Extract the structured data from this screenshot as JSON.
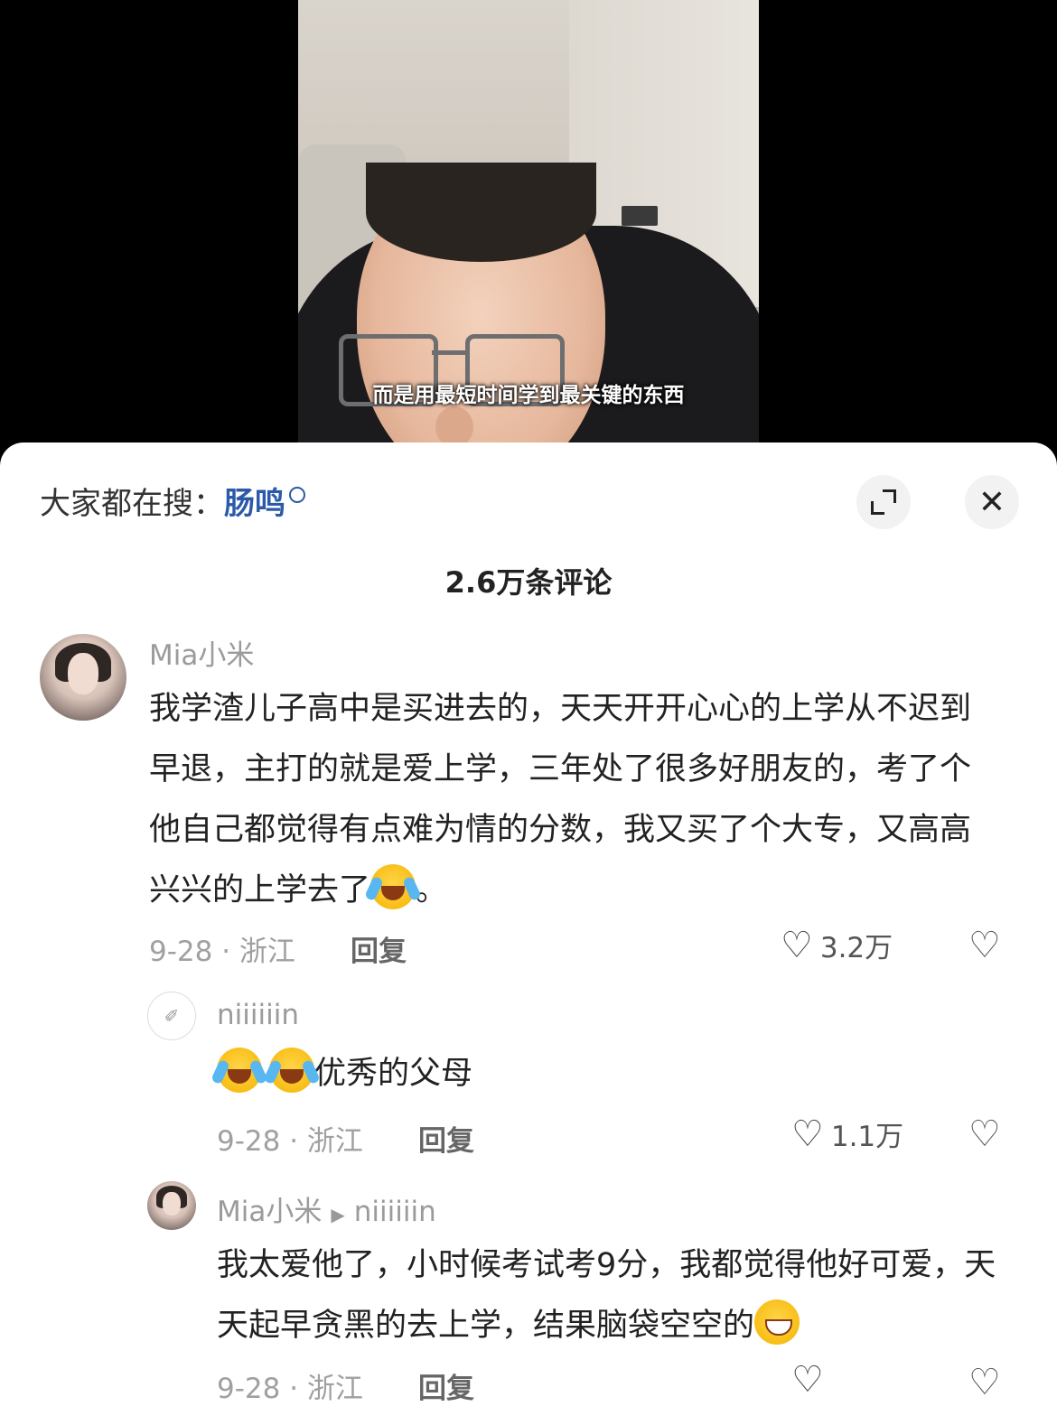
{
  "video": {
    "subtitle": "而是用最短时间学到最关键的东西"
  },
  "search": {
    "prefix": "大家都在搜：",
    "term": "肠鸣"
  },
  "buttons": {
    "close_label": "✕"
  },
  "comment_count": "2.6万条评论",
  "comments": [
    {
      "username": "Mia小米",
      "text": "我学渣儿子高中是买进去的，天天开开心心的上学从不迟到早退，主打的就是爱上学，三年处了很多好朋友的，考了个他自己都觉得有点难为情的分数，我又买了个大专，又高高兴兴的上学去了",
      "text_suffix": "。",
      "date_location": "9-28 · 浙江",
      "reply_label": "回复",
      "likes": "3.2万"
    },
    {
      "username": "niiiiiin",
      "text": "优秀的父母",
      "date_location": "9-28 · 浙江",
      "reply_label": "回复",
      "likes": "1.1万"
    },
    {
      "username": "Mia小米",
      "reply_to": "niiiiiin",
      "text": "我太爱他了，小时候考试考9分，我都觉得他好可爱，天天起早贪黑的去上学，结果脑袋空空的",
      "date_location": "9-28 · 浙江",
      "reply_label": "回复"
    }
  ],
  "colors": {
    "search_term": "#2c5aa8",
    "muted": "#a0a0a0",
    "body": "#222222"
  }
}
